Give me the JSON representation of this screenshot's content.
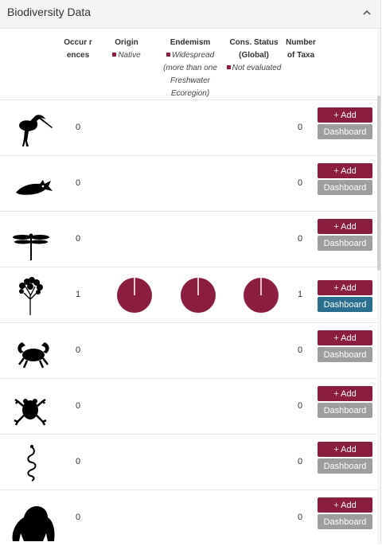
{
  "panel": {
    "title": "Biodiversity Data"
  },
  "columns": {
    "occurrences": "Occur rences",
    "origin": {
      "title": "Origin",
      "legend": "Native"
    },
    "endemism": {
      "title": "Endemism",
      "legend": [
        "Widespread",
        "(more than one",
        "Freshwater",
        "Ecoregion)"
      ]
    },
    "cons_status": {
      "title": [
        "Cons. Status",
        "(Global)"
      ],
      "legend": "Not evaluated"
    },
    "taxa": [
      "Number",
      "of Taxa"
    ]
  },
  "colors": {
    "accent": "#8b1e3f",
    "dashboard_active": "#2a6f8e",
    "dashboard_inactive": "#9e9e9e"
  },
  "rows": [
    {
      "icon": "bird-icon",
      "occurrences": "0",
      "taxa": "0",
      "add": "+ Add",
      "dashboard": "Dashboard"
    },
    {
      "icon": "fish-icon",
      "occurrences": "0",
      "taxa": "0",
      "add": "+ Add",
      "dashboard": "Dashboard"
    },
    {
      "icon": "dragonfly-icon",
      "occurrences": "0",
      "taxa": "0",
      "add": "+ Add",
      "dashboard": "Dashboard"
    },
    {
      "icon": "tree-icon",
      "occurrences": "1",
      "taxa": "1",
      "add": "+ Add",
      "dashboard": "Dashboard"
    },
    {
      "icon": "crab-icon",
      "occurrences": "0",
      "taxa": "0",
      "add": "+ Add",
      "dashboard": "Dashboard"
    },
    {
      "icon": "frog-icon",
      "occurrences": "0",
      "taxa": "0",
      "add": "+ Add",
      "dashboard": "Dashboard"
    },
    {
      "icon": "snake-icon",
      "occurrences": "0",
      "taxa": "0",
      "add": "+ Add",
      "dashboard": "Dashboard"
    },
    {
      "icon": "gorilla-icon",
      "occurrences": "0",
      "taxa": "0",
      "add": "+ Add",
      "dashboard": "Dashboard"
    }
  ]
}
